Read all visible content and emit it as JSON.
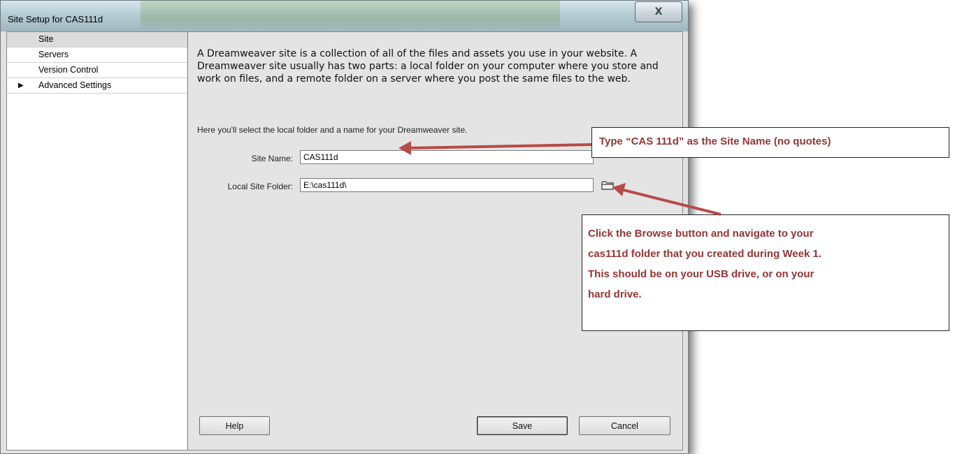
{
  "window": {
    "title": "Site Setup for CAS111d",
    "close_glyph": "X"
  },
  "sidebar": {
    "items": [
      {
        "label": "Site",
        "selected": true,
        "expander": ""
      },
      {
        "label": "Servers",
        "selected": false,
        "expander": ""
      },
      {
        "label": "Version Control",
        "selected": false,
        "expander": ""
      },
      {
        "label": "Advanced Settings",
        "selected": false,
        "expander": "▶"
      }
    ]
  },
  "main": {
    "description": "A Dreamweaver site is a collection of all of the files and assets you use in your website. A Dreamweaver site usually has two parts: a local folder on your computer where you store and work on files, and a remote folder on a server where you post the same files to the web.",
    "instruction": "Here you'll select the local folder and a name for your Dreamweaver site.",
    "site_name_label": "Site Name:",
    "site_name_value": "CAS111d",
    "local_folder_label": "Local Site Folder:",
    "local_folder_value": "E:\\cas111d\\",
    "browse_icon": "folder-icon"
  },
  "buttons": {
    "help": "Help",
    "save": "Save",
    "cancel": "Cancel"
  },
  "callouts": {
    "site_name_tip": "Type “CAS 111d” as the Site Name (no quotes)",
    "browse_tip_lines": [
      "Click the Browse button and navigate to your",
      "cas111d folder that you created during Week 1.",
      "This should be on your USB drive, or on your",
      "hard drive."
    ]
  },
  "colors": {
    "callout_text": "#943634",
    "arrow": "#b84a47"
  }
}
